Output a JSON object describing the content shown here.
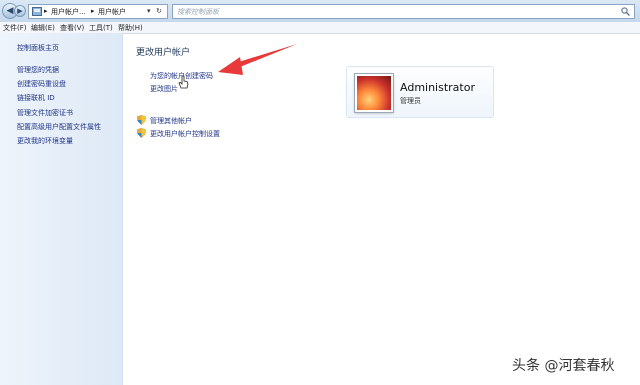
{
  "addressbar": {
    "back_glyph": "◀",
    "forward_glyph": "▶",
    "crumbs": [
      "用户帐户...",
      "用户帐户"
    ],
    "separator": "▸",
    "dropdown_glyph": "▾",
    "refresh_glyph": "↻",
    "search_placeholder": "搜索控制面板"
  },
  "menubar": [
    "文件(F)",
    "编辑(E)",
    "查看(V)",
    "工具(T)",
    "帮助(H)"
  ],
  "sidebar": {
    "home": "控制面板主页",
    "items": [
      "管理您的凭据",
      "创建密码重设盘",
      "链接联机 ID",
      "管理文件加密证书",
      "配置高级用户配置文件属性",
      "更改我的环境变量"
    ]
  },
  "main": {
    "title": "更改用户帐户",
    "links": [
      "为您的帐户创建密码",
      "更改图片"
    ],
    "admin_links": [
      "管理其他帐户",
      "更改用户帐户控制设置"
    ]
  },
  "account": {
    "name": "Administrator",
    "role": "管理员"
  },
  "watermark": "头条 @河套春秋",
  "colors": {
    "link": "#1e3287",
    "arrow": "#e83a3a",
    "sidebar": "#e6eff9"
  }
}
